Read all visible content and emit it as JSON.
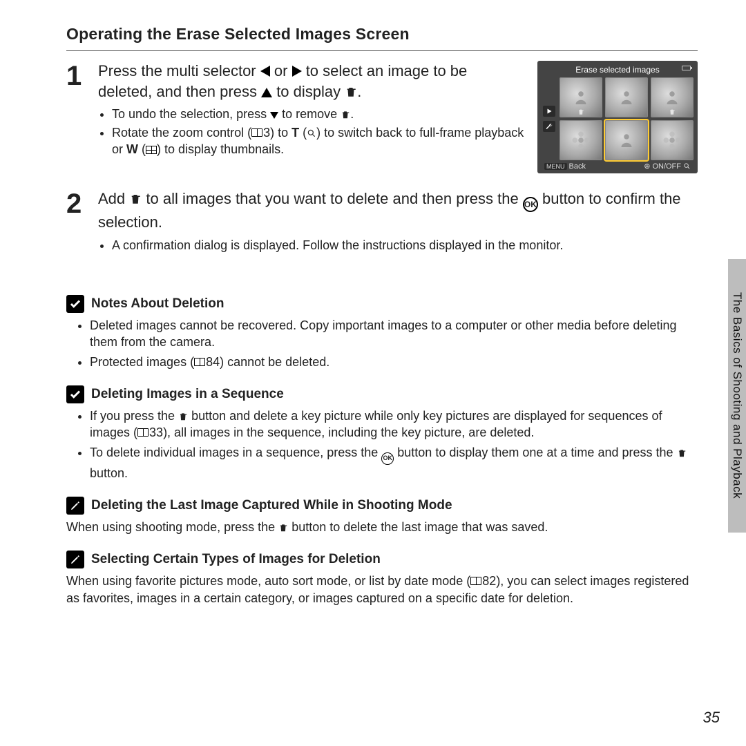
{
  "title": "Operating the Erase Selected Images Screen",
  "step1": {
    "num": "1",
    "heading_a": "Press the multi selector ",
    "heading_b": " or ",
    "heading_c": " to select an image to be deleted, and then press ",
    "heading_d": " to display ",
    "heading_e": ".",
    "bullet1_a": "To undo the selection, press ",
    "bullet1_b": " to remove ",
    "bullet1_c": ".",
    "bullet2_a": "Rotate the zoom control (",
    "bullet2_ref": "3",
    "bullet2_b": ") to ",
    "bullet2_T": "T",
    "bullet2_c": " (",
    "bullet2_d": ") to switch back to full-frame playback or ",
    "bullet2_W": "W",
    "bullet2_e": " (",
    "bullet2_f": ") to display thumbnails."
  },
  "lcd": {
    "title": "Erase selected images",
    "back": "Back",
    "onoff": "ON/OFF"
  },
  "step2": {
    "num": "2",
    "heading_a": "Add ",
    "heading_b": " to all images that you want to delete and then press the ",
    "heading_c": " button to confirm the selection.",
    "bullet1": "A confirmation dialog is displayed. Follow the instructions displayed in the monitor."
  },
  "notes1": {
    "title": "Notes About Deletion",
    "b1": "Deleted images cannot be recovered. Copy important images to a computer or other media before deleting them from the camera.",
    "b2_a": "Protected images (",
    "b2_ref": "84",
    "b2_b": ") cannot be deleted."
  },
  "notes2": {
    "title": "Deleting Images in a Sequence",
    "b1_a": "If you press the ",
    "b1_b": " button and delete a key picture while only key pictures are displayed for sequences of images (",
    "b1_ref": "33",
    "b1_c": "), all images in the sequence, including the key picture, are deleted.",
    "b2_a": "To delete individual images in a sequence, press the ",
    "b2_b": " button to display them one at a time and press the ",
    "b2_c": " button."
  },
  "notes3": {
    "title": "Deleting the Last Image Captured While in Shooting Mode",
    "p_a": "When using shooting mode, press the ",
    "p_b": " button to delete the last image that was saved."
  },
  "notes4": {
    "title": "Selecting Certain Types of Images for Deletion",
    "p_a": "When using favorite pictures mode, auto sort mode, or list by date mode (",
    "p_ref": "82",
    "p_b": "), you can select images registered as favorites, images in a certain category, or images captured on a specific date for deletion."
  },
  "side": "The Basics of Shooting and Playback",
  "page": "35"
}
